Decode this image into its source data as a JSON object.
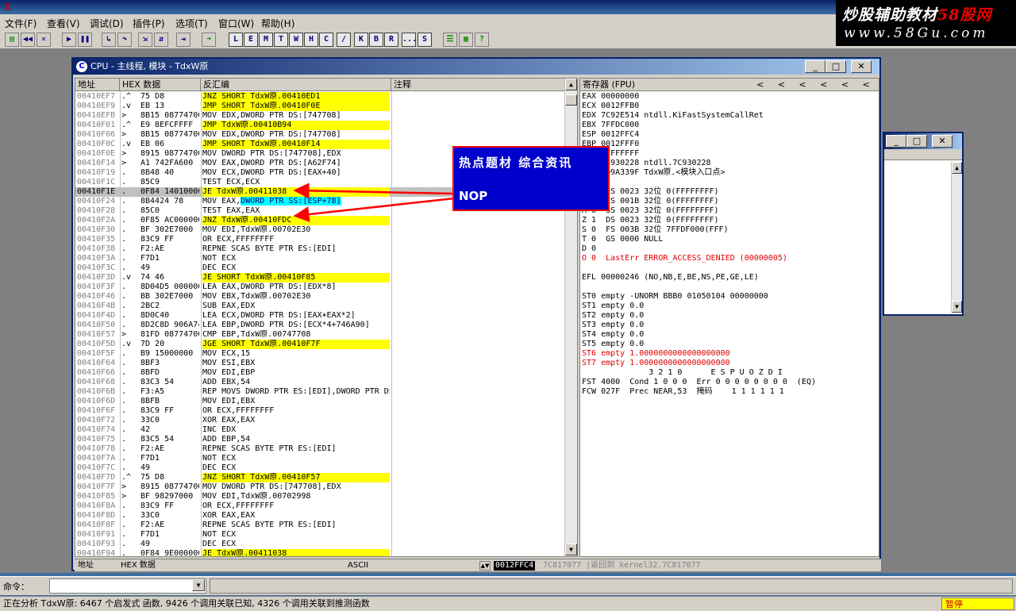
{
  "app": {
    "icon_label": "X"
  },
  "menu": [
    {
      "label": "文件(F)"
    },
    {
      "label": "查看(V)"
    },
    {
      "label": "调试(D)"
    },
    {
      "label": "插件(P)"
    },
    {
      "label": "选项(T)"
    },
    {
      "label": "窗口(W)"
    },
    {
      "label": "帮助(H)"
    }
  ],
  "toolbar_letters": [
    "L",
    "E",
    "M",
    "T",
    "W",
    "H",
    "C",
    "/",
    "K",
    "B",
    "R",
    "...",
    "S"
  ],
  "watermark": {
    "line1_a": "炒股辅助教材",
    "line1_b": "58股网",
    "line2": "www.58Gu.com"
  },
  "cpu_window": {
    "title": "CPU - 主线程, 模块 - TdxW原",
    "col_addr": "地址",
    "col_hex": "HEX 数据",
    "col_dis": "反汇编",
    "col_comment": "注释",
    "regs_title": "寄存器 (FPU)",
    "regs_arrows": "<     <     <     <     <     <"
  },
  "rows": [
    {
      "addr": "00410EF7",
      "mark": ".^",
      "hex": "75 D8",
      "dis": "JNZ SHORT TdxW原.00410ED1",
      "hl": true
    },
    {
      "addr": "00410EF9",
      "mark": ".v",
      "hex": "EB 13",
      "dis": "JMP SHORT TdxW原.00410F0E",
      "hl": true
    },
    {
      "addr": "00410EFB",
      "mark": ">",
      "hex": "8B15 08774700",
      "dis": "MOV EDX,DWORD PTR DS:[747708]",
      "hl": false
    },
    {
      "addr": "00410F01",
      "mark": ".^",
      "hex": "E9 8EFCFFFF",
      "dis": "JMP TdxW原.00410B94",
      "hl": true
    },
    {
      "addr": "00410F06",
      "mark": ">",
      "hex": "8B15 08774700",
      "dis": "MOV EDX,DWORD PTR DS:[747708]",
      "hl": false
    },
    {
      "addr": "00410F0C",
      "mark": ".v",
      "hex": "EB 06",
      "dis": "JMP SHORT TdxW原.00410F14",
      "hl": true
    },
    {
      "addr": "00410F0E",
      "mark": ">",
      "hex": "8915 08774700",
      "dis": "MOV DWORD PTR DS:[747708],EDX",
      "hl": false
    },
    {
      "addr": "00410F14",
      "mark": ">",
      "hex": "A1 742FA600",
      "dis": "MOV EAX,DWORD PTR DS:[A62F74]",
      "hl": false
    },
    {
      "addr": "00410F19",
      "mark": ".",
      "hex": "8B48 40",
      "dis": "MOV ECX,DWORD PTR DS:[EAX+40]",
      "hl": false
    },
    {
      "addr": "00410F1C",
      "mark": ".",
      "hex": "85C9",
      "dis": "TEST ECX,ECX",
      "hl": false
    },
    {
      "addr": "00410F1E",
      "mark": ".",
      "hex": "0F84 14010000",
      "dis": "JE TdxW原.00411038",
      "hl": true,
      "sel": true
    },
    {
      "addr": "00410F24",
      "mark": ".",
      "hex": "8B4424 78",
      "dis": "MOV EAX,DWORD PTR SS:[ESP+78]",
      "hl": false,
      "blue": true
    },
    {
      "addr": "00410F28",
      "mark": ".",
      "hex": "85C0",
      "dis": "TEST EAX,EAX",
      "hl": false
    },
    {
      "addr": "00410F2A",
      "mark": ".",
      "hex": "0F85 AC000000",
      "dis": "JNZ TdxW原.00410FDC",
      "hl": true
    },
    {
      "addr": "00410F30",
      "mark": ".",
      "hex": "BF 302E7000",
      "dis": "MOV EDI,TdxW原.00702E30",
      "hl": false
    },
    {
      "addr": "00410F35",
      "mark": ".",
      "hex": "83C9 FF",
      "dis": "OR ECX,FFFFFFFF",
      "hl": false
    },
    {
      "addr": "00410F38",
      "mark": ".",
      "hex": "F2:AE",
      "dis": "REPNE SCAS BYTE PTR ES:[EDI]",
      "hl": false
    },
    {
      "addr": "00410F3A",
      "mark": ".",
      "hex": "F7D1",
      "dis": "NOT ECX",
      "hl": false
    },
    {
      "addr": "00410F3C",
      "mark": ".",
      "hex": "49",
      "dis": "DEC ECX",
      "hl": false
    },
    {
      "addr": "00410F3D",
      "mark": ".v",
      "hex": "74 46",
      "dis": "JE SHORT TdxW原.00410F85",
      "hl": true
    },
    {
      "addr": "00410F3F",
      "mark": ".",
      "hex": "8D04D5 00000000",
      "dis": "LEA EAX,DWORD PTR DS:[EDX*8]",
      "hl": false
    },
    {
      "addr": "00410F46",
      "mark": ".",
      "hex": "BB 302E7000",
      "dis": "MOV EBX,TdxW原.00702E30",
      "hl": false
    },
    {
      "addr": "00410F4B",
      "mark": ".",
      "hex": "2BC2",
      "dis": "SUB EAX,EDX",
      "hl": false
    },
    {
      "addr": "00410F4D",
      "mark": ".",
      "hex": "8D0C40",
      "dis": "LEA ECX,DWORD PTR DS:[EAX+EAX*2]",
      "hl": false
    },
    {
      "addr": "00410F50",
      "mark": ".",
      "hex": "8D2C8D 906A7400",
      "dis": "LEA EBP,DWORD PTR DS:[ECX*4+746A90]",
      "hl": false
    },
    {
      "addr": "00410F57",
      "mark": ">",
      "hex": "81FD 08774700",
      "dis": "CMP EBP,TdxW原.00747708",
      "hl": false
    },
    {
      "addr": "00410F5D",
      "mark": ".v",
      "hex": "7D 20",
      "dis": "JGE SHORT TdxW原.00410F7F",
      "hl": true
    },
    {
      "addr": "00410F5F",
      "mark": ".",
      "hex": "B9 15000000",
      "dis": " MOV ECX,15",
      "hl": false
    },
    {
      "addr": "00410F64",
      "mark": ".",
      "hex": "8BF3",
      "dis": " MOV ESI,EBX",
      "hl": false
    },
    {
      "addr": "00410F66",
      "mark": ".",
      "hex": "8BFD",
      "dis": " MOV EDI,EBP",
      "hl": false
    },
    {
      "addr": "00410F68",
      "mark": ".",
      "hex": "83C3 54",
      "dis": " ADD EBX,54",
      "hl": false
    },
    {
      "addr": "00410F6B",
      "mark": ".",
      "hex": "F3:A5",
      "dis": " REP MOVS DWORD PTR ES:[EDI],DWORD PTR DS:[ESI]",
      "hl": false
    },
    {
      "addr": "00410F6D",
      "mark": ".",
      "hex": "8BFB",
      "dis": " MOV EDI,EBX",
      "hl": false
    },
    {
      "addr": "00410F6F",
      "mark": ".",
      "hex": "83C9 FF",
      "dis": " OR ECX,FFFFFFFF",
      "hl": false
    },
    {
      "addr": "00410F72",
      "mark": ".",
      "hex": "33C0",
      "dis": " XOR EAX,EAX",
      "hl": false
    },
    {
      "addr": "00410F74",
      "mark": ".",
      "hex": "42",
      "dis": " INC EDX",
      "hl": false
    },
    {
      "addr": "00410F75",
      "mark": ".",
      "hex": "83C5 54",
      "dis": " ADD EBP,54",
      "hl": false
    },
    {
      "addr": "00410F78",
      "mark": ".",
      "hex": "F2:AE",
      "dis": " REPNE SCAS BYTE PTR ES:[EDI]",
      "hl": false
    },
    {
      "addr": "00410F7A",
      "mark": ".",
      "hex": "F7D1",
      "dis": " NOT ECX",
      "hl": false
    },
    {
      "addr": "00410F7C",
      "mark": ".",
      "hex": "49",
      "dis": " DEC ECX",
      "hl": false
    },
    {
      "addr": "00410F7D",
      "mark": ".^",
      "hex": "75 D8",
      "dis": "JNZ SHORT TdxW原.00410F57",
      "hl": true
    },
    {
      "addr": "00410F7F",
      "mark": ">",
      "hex": "8915 08774700",
      "dis": "MOV DWORD PTR DS:[747708],EDX",
      "hl": false
    },
    {
      "addr": "00410F85",
      "mark": ">",
      "hex": "BF 98297000",
      "dis": "MOV EDI,TdxW原.00702998",
      "hl": false
    },
    {
      "addr": "00410F8A",
      "mark": ".",
      "hex": "83C9 FF",
      "dis": "OR ECX,FFFFFFFF",
      "hl": false
    },
    {
      "addr": "00410F8D",
      "mark": ".",
      "hex": "33C0",
      "dis": "XOR EAX,EAX",
      "hl": false
    },
    {
      "addr": "00410F8F",
      "mark": ".",
      "hex": "F2:AE",
      "dis": "REPNE SCAS BYTE PTR ES:[EDI]",
      "hl": false
    },
    {
      "addr": "00410F91",
      "mark": ".",
      "hex": "F7D1",
      "dis": "NOT ECX",
      "hl": false
    },
    {
      "addr": "00410F93",
      "mark": ".",
      "hex": "49",
      "dis": "DEC ECX",
      "hl": false
    },
    {
      "addr": "00410F94",
      "mark": ".",
      "hex": "0F84 9E000000",
      "dis": "JE TdxW原.00411038",
      "hl": true
    }
  ],
  "registers": [
    {
      "text": "EAX 00000000",
      "red": false
    },
    {
      "text": "ECX 0012FFB0",
      "red": false
    },
    {
      "text": "EDX 7C92E514 ntdll.KiFastSystemCallRet",
      "red": false
    },
    {
      "text": "EBX 7FFDC000",
      "red": false
    },
    {
      "text": "ESP 0012FFC4",
      "red": false
    },
    {
      "text": "EBP 0012FFF0",
      "red": false
    },
    {
      "text": "ESI FFFFFFFF",
      "red": false
    },
    {
      "text": "EDI 7C930228 ntdll.7C930228",
      "red": false
    },
    {
      "text": "EIP 009A339F TdxW原.<模块入口点>",
      "red": false
    },
    {
      "text": "",
      "red": false
    },
    {
      "text": "C 0  ES 0023 32位 0(FFFFFFFF)",
      "red": false
    },
    {
      "text": "P 1  CS 001B 32位 0(FFFFFFFF)",
      "red": false
    },
    {
      "text": "A 0  SS 0023 32位 0(FFFFFFFF)",
      "red": false
    },
    {
      "text": "Z 1  DS 0023 32位 0(FFFFFFFF)",
      "red": false
    },
    {
      "text": "S 0  FS 003B 32位 7FFDF000(FFF)",
      "red": false
    },
    {
      "text": "T 0  GS 0000 NULL",
      "red": false
    },
    {
      "text": "D 0",
      "red": false
    },
    {
      "text": "O 0  LastErr ERROR_ACCESS_DENIED (00000005)",
      "red": true
    },
    {
      "text": "",
      "red": false
    },
    {
      "text": "EFL 00000246 (NO,NB,E,BE,NS,PE,GE,LE)",
      "red": false
    },
    {
      "text": "",
      "red": false
    },
    {
      "text": "ST0 empty -UNORM BBB0 01050104 00000000",
      "red": false
    },
    {
      "text": "ST1 empty 0.0",
      "red": false
    },
    {
      "text": "ST2 empty 0.0",
      "red": false
    },
    {
      "text": "ST3 empty 0.0",
      "red": false
    },
    {
      "text": "ST4 empty 0.0",
      "red": false
    },
    {
      "text": "ST5 empty 0.0",
      "red": false
    },
    {
      "text": "ST6 empty 1.0000000000000000000",
      "red": true
    },
    {
      "text": "ST7 empty 1.0000000000000000000",
      "red": true
    },
    {
      "text": "              3 2 1 0      E S P U O Z D I",
      "red": false
    },
    {
      "text": "FST 4000  Cond 1 0 0 0  Err 0 0 0 0 0 0 0 0  (EQ)",
      "red": false
    },
    {
      "text": "FCW 027F  Prec NEAR,53  掩码    1 1 1 1 1 1",
      "red": false
    }
  ],
  "dump_header": {
    "addr": "地址",
    "hex": "HEX 数据",
    "ascii": "ASCII",
    "stack_addr": "0012FFC4",
    "stack_text": "7C817077 |返回到 kernel32.7C817077"
  },
  "callout": {
    "line1": "热点题材 综合资讯",
    "line2": "NOP"
  },
  "command": {
    "label": "命令："
  },
  "status": {
    "text": "正在分析 TdxW原: 6467 个启发式 函数, 9426 个调用关联已知, 4326 个调用关联到推测函数",
    "state": "暂停"
  },
  "colors": {
    "highlight": "#ffff00",
    "selection": "#c0c0c0",
    "callout_bg": "#0000cc",
    "arrow": "#ff0000"
  }
}
